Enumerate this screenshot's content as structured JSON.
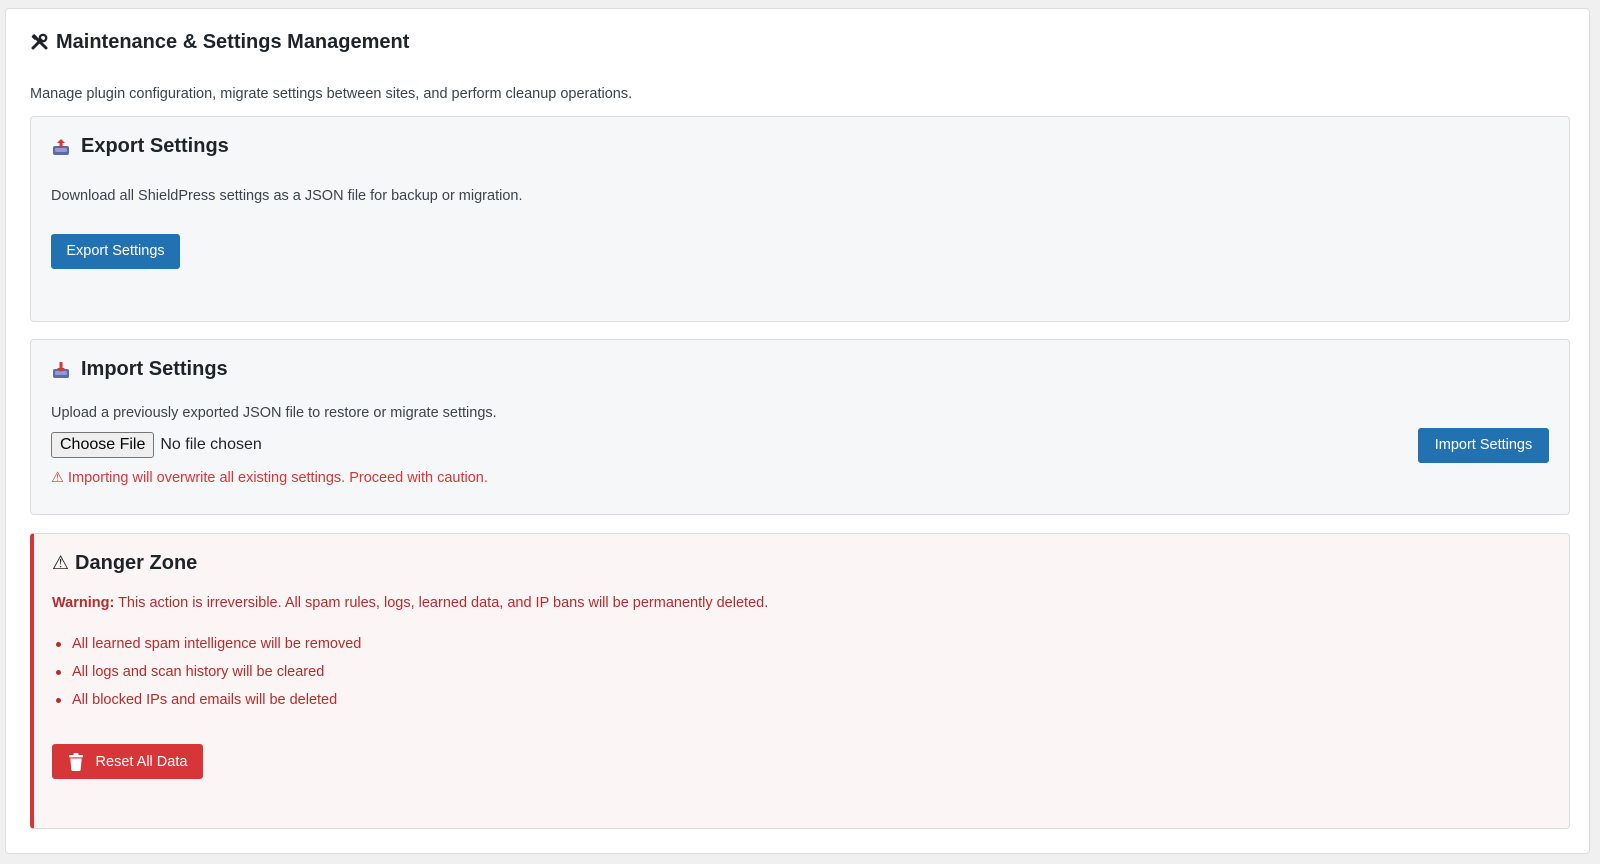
{
  "page": {
    "title": "Maintenance & Settings Management",
    "title_icon": "tools-icon",
    "description": "Manage plugin configuration, migrate settings between sites, and perform cleanup operations."
  },
  "export": {
    "title": "Export Settings",
    "icon": "outbox-tray-icon",
    "description": "Download all ShieldPress settings as a JSON file for backup or migration.",
    "button_label": "Export Settings"
  },
  "import": {
    "title": "Import Settings",
    "icon": "inbox-tray-icon",
    "description": "Upload a previously exported JSON file to restore or migrate settings.",
    "file_button_label": "Choose File",
    "file_status": "No file chosen",
    "warning_icon": "⚠",
    "warning": "Importing will overwrite all existing settings. Proceed with caution.",
    "button_label": "Import Settings"
  },
  "danger": {
    "icon": "⚠",
    "title": "Danger Zone",
    "warning_label": "Warning:",
    "warning_text": " This action is irreversible. All spam rules, logs, learned data, and IP bans will be permanently deleted.",
    "items": [
      "All learned spam intelligence will be removed",
      "All logs and scan history will be cleared",
      "All blocked IPs and emails will be deleted"
    ],
    "button_label": "Reset All Data",
    "button_icon": "trash-icon"
  },
  "colors": {
    "primary": "#2271b1",
    "danger": "#d63638",
    "danger_text": "#b32d2e"
  }
}
